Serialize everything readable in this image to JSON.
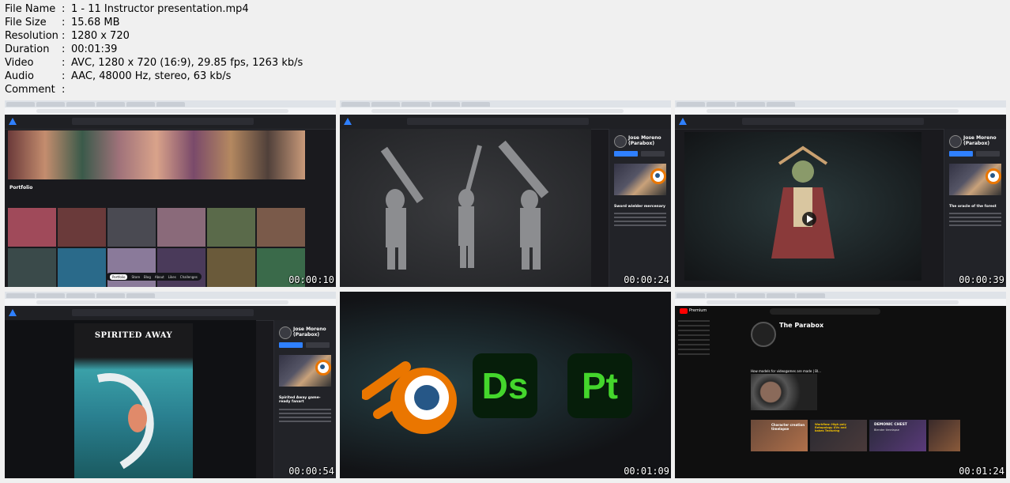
{
  "metadata": [
    {
      "key": "File Name",
      "value": "1 - 11 Instructor presentation.mp4"
    },
    {
      "key": "File Size",
      "value": "15.68 MB"
    },
    {
      "key": "Resolution",
      "value": "1280 x 720"
    },
    {
      "key": "Duration",
      "value": "00:01:39"
    },
    {
      "key": "Video",
      "value": "AVC, 1280 x 720 (16:9), 29.85 fps, 1263 kb/s"
    },
    {
      "key": "Audio",
      "value": "AAC, 48000 Hz, stereo, 63 kb/s"
    },
    {
      "key": "Comment",
      "value": ""
    }
  ],
  "thumbnails": [
    {
      "timestamp": "00:00:10",
      "scene": "artstation-portfolio",
      "labels": {
        "portfolio": "Portfolio",
        "menu": [
          "Portfolio",
          "Store",
          "Blog",
          "About",
          "Likes",
          "Challenges"
        ]
      }
    },
    {
      "timestamp": "00:00:24",
      "scene": "sword-models",
      "labels": {
        "author": "Jose Moreno (Parabox)",
        "project": "Sword wielder mercenary",
        "tag": "blender"
      }
    },
    {
      "timestamp": "00:00:39",
      "scene": "oracle-forest",
      "labels": {
        "author": "Jose Moreno (Parabox)",
        "project": "The oracle of the forest",
        "tag": "blender"
      }
    },
    {
      "timestamp": "00:00:54",
      "scene": "spirited-away",
      "labels": {
        "title": "SPIRITED AWAY",
        "author": "Jose Moreno (Parabox)",
        "project": "Spirited Away game-ready fanart",
        "tag": "blender"
      }
    },
    {
      "timestamp": "00:01:09",
      "scene": "software-logos",
      "labels": {
        "logos": [
          "Ds",
          "Pt"
        ]
      }
    },
    {
      "timestamp": "00:01:24",
      "scene": "youtube-channel",
      "labels": {
        "channel": "The Parabox",
        "brand": "Premium",
        "video1": "How models for videogames are made | Bl...",
        "shelf1": "Character creation timelapse",
        "shelf2": "Workflow: High poly Retopology UVs and bakes Texturing",
        "shelf3": "DEMONIC CHEST",
        "shelf3_sub": "Blender timelapse"
      }
    }
  ],
  "colors": {
    "accent": "#2f80ff",
    "blender_orange": "#ea7600",
    "adobe_green": "#44d62c",
    "youtube_red": "#ff0000"
  }
}
